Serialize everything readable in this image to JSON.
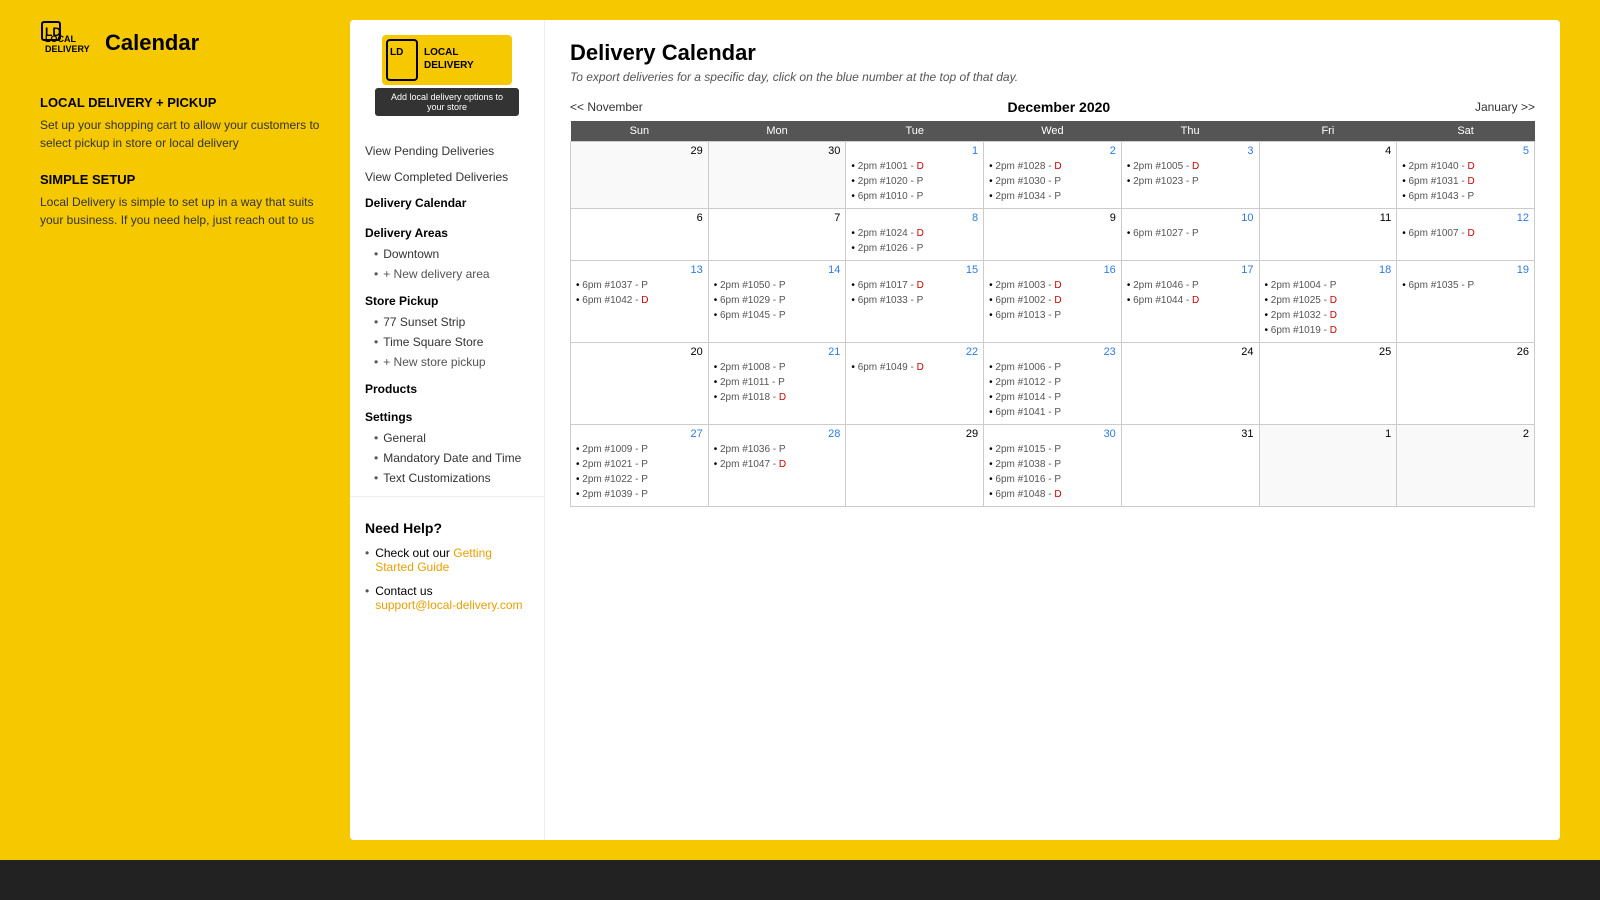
{
  "header": {
    "logo_text": "Calendar"
  },
  "left_panel": {
    "sections": [
      {
        "title": "LOCAL DELIVERY + PICKUP",
        "content": "Set up your shopping cart to allow your customers to select pickup in store or local delivery"
      },
      {
        "title": "SIMPLE SETUP",
        "content": "Local Delivery is simple to set up in a way that suits your business. If you need help, just reach out to us"
      }
    ]
  },
  "sidebar": {
    "logo_alt": "Local Delivery",
    "add_btn": "Add local delivery options to your store",
    "nav_items": [
      {
        "label": "View Pending Deliveries",
        "active": false
      },
      {
        "label": "View Completed Deliveries",
        "active": false
      },
      {
        "label": "Delivery Calendar",
        "active": true
      }
    ],
    "delivery_areas": {
      "title": "Delivery Areas",
      "items": [
        "Downtown",
        "+ New delivery area"
      ]
    },
    "store_pickup": {
      "title": "Store Pickup",
      "items": [
        "77 Sunset Strip",
        "Time Square Store",
        "+ New store pickup"
      ]
    },
    "products": {
      "title": "Products"
    },
    "settings": {
      "title": "Settings",
      "items": [
        "General",
        "Mandatory Date and Time",
        "Text Customizations"
      ]
    }
  },
  "calendar": {
    "title": "Delivery Calendar",
    "subtitle": "To export deliveries for a specific day, click on the blue number at the top of that day.",
    "prev_nav": "<< November",
    "next_nav": "January >>",
    "month_title": "December 2020",
    "headers": [
      "Sun",
      "Mon",
      "Tue",
      "Wed",
      "Thu",
      "Fri",
      "Sat"
    ],
    "weeks": [
      {
        "days": [
          {
            "number": "29",
            "grayed": true,
            "events": []
          },
          {
            "number": "30",
            "grayed": true,
            "events": []
          },
          {
            "number": "1",
            "blue": true,
            "events": [
              {
                "time": "2pm",
                "order": "#1001",
                "type": "D"
              },
              {
                "time": "2pm",
                "order": "#1020",
                "type": "P"
              },
              {
                "time": "6pm",
                "order": "#1010",
                "type": "P"
              }
            ]
          },
          {
            "number": "2",
            "blue": true,
            "events": [
              {
                "time": "2pm",
                "order": "#1028",
                "type": "D"
              },
              {
                "time": "2pm",
                "order": "#1030",
                "type": "P"
              },
              {
                "time": "2pm",
                "order": "#1034",
                "type": "P"
              }
            ]
          },
          {
            "number": "3",
            "blue": true,
            "events": [
              {
                "time": "2pm",
                "order": "#1005",
                "type": "D"
              },
              {
                "time": "2pm",
                "order": "#1023",
                "type": "P"
              }
            ]
          },
          {
            "number": "4",
            "events": []
          },
          {
            "number": "5",
            "blue": true,
            "events": [
              {
                "time": "2pm",
                "order": "#1040",
                "type": "D"
              },
              {
                "time": "6pm",
                "order": "#1031",
                "type": "D"
              },
              {
                "time": "6pm",
                "order": "#1043",
                "type": "P"
              }
            ]
          }
        ]
      },
      {
        "days": [
          {
            "number": "6",
            "events": []
          },
          {
            "number": "7",
            "events": []
          },
          {
            "number": "8",
            "blue": true,
            "events": [
              {
                "time": "2pm",
                "order": "#1024",
                "type": "D"
              },
              {
                "time": "2pm",
                "order": "#1026",
                "type": "P"
              }
            ]
          },
          {
            "number": "9",
            "events": []
          },
          {
            "number": "10",
            "blue": true,
            "events": [
              {
                "time": "6pm",
                "order": "#1027",
                "type": "P"
              }
            ]
          },
          {
            "number": "11",
            "events": []
          },
          {
            "number": "12",
            "blue": true,
            "events": [
              {
                "time": "6pm",
                "order": "#1007",
                "type": "D"
              }
            ]
          }
        ]
      },
      {
        "days": [
          {
            "number": "13",
            "blue": true,
            "events": [
              {
                "time": "6pm",
                "order": "#1037",
                "type": "P"
              },
              {
                "time": "6pm",
                "order": "#1042",
                "type": "D"
              }
            ]
          },
          {
            "number": "14",
            "blue": true,
            "events": [
              {
                "time": "2pm",
                "order": "#1050",
                "type": "P"
              },
              {
                "time": "6pm",
                "order": "#1029",
                "type": "P"
              },
              {
                "time": "6pm",
                "order": "#1045",
                "type": "P"
              }
            ]
          },
          {
            "number": "15",
            "blue": true,
            "events": [
              {
                "time": "6pm",
                "order": "#1017",
                "type": "D"
              },
              {
                "time": "6pm",
                "order": "#1033",
                "type": "P"
              }
            ]
          },
          {
            "number": "16",
            "blue": true,
            "events": [
              {
                "time": "2pm",
                "order": "#1003",
                "type": "D"
              },
              {
                "time": "6pm",
                "order": "#1002",
                "type": "D"
              },
              {
                "time": "6pm",
                "order": "#1013",
                "type": "P"
              }
            ]
          },
          {
            "number": "17",
            "blue": true,
            "events": [
              {
                "time": "2pm",
                "order": "#1046",
                "type": "P"
              },
              {
                "time": "6pm",
                "order": "#1044",
                "type": "D"
              }
            ]
          },
          {
            "number": "18",
            "blue": true,
            "events": [
              {
                "time": "2pm",
                "order": "#1004",
                "type": "P"
              },
              {
                "time": "2pm",
                "order": "#1025",
                "type": "D"
              },
              {
                "time": "2pm",
                "order": "#1032",
                "type": "D"
              },
              {
                "time": "6pm",
                "order": "#1019",
                "type": "D"
              }
            ]
          },
          {
            "number": "19",
            "blue": true,
            "events": [
              {
                "time": "6pm",
                "order": "#1035",
                "type": "P"
              }
            ]
          }
        ]
      },
      {
        "days": [
          {
            "number": "20",
            "events": []
          },
          {
            "number": "21",
            "blue": true,
            "events": [
              {
                "time": "2pm",
                "order": "#1008",
                "type": "P"
              },
              {
                "time": "2pm",
                "order": "#1011",
                "type": "P"
              },
              {
                "time": "2pm",
                "order": "#1018",
                "type": "D"
              }
            ]
          },
          {
            "number": "22",
            "blue": true,
            "events": [
              {
                "time": "6pm",
                "order": "#1049",
                "type": "D"
              }
            ]
          },
          {
            "number": "23",
            "blue": true,
            "events": [
              {
                "time": "2pm",
                "order": "#1006",
                "type": "P"
              },
              {
                "time": "2pm",
                "order": "#1012",
                "type": "P"
              },
              {
                "time": "2pm",
                "order": "#1014",
                "type": "P"
              },
              {
                "time": "6pm",
                "order": "#1041",
                "type": "P"
              }
            ]
          },
          {
            "number": "24",
            "events": []
          },
          {
            "number": "25",
            "events": []
          },
          {
            "number": "26",
            "events": []
          }
        ]
      },
      {
        "days": [
          {
            "number": "27",
            "blue": true,
            "events": [
              {
                "time": "2pm",
                "order": "#1009",
                "type": "P"
              },
              {
                "time": "2pm",
                "order": "#1021",
                "type": "P"
              },
              {
                "time": "2pm",
                "order": "#1022",
                "type": "P"
              },
              {
                "time": "2pm",
                "order": "#1039",
                "type": "P"
              }
            ]
          },
          {
            "number": "28",
            "blue": true,
            "events": [
              {
                "time": "2pm",
                "order": "#1036",
                "type": "P"
              },
              {
                "time": "2pm",
                "order": "#1047",
                "type": "D"
              }
            ]
          },
          {
            "number": "29",
            "events": []
          },
          {
            "number": "30",
            "blue": true,
            "events": [
              {
                "time": "2pm",
                "order": "#1015",
                "type": "P"
              },
              {
                "time": "2pm",
                "order": "#1038",
                "type": "P"
              },
              {
                "time": "6pm",
                "order": "#1016",
                "type": "P"
              },
              {
                "time": "6pm",
                "order": "#1048",
                "type": "D"
              }
            ]
          },
          {
            "number": "31",
            "events": []
          },
          {
            "number": "1",
            "grayed": true,
            "events": []
          },
          {
            "number": "2",
            "grayed": true,
            "events": []
          }
        ]
      }
    ]
  },
  "need_help": {
    "title": "Need Help?",
    "items": [
      {
        "text": "Check out our ",
        "link_text": "Getting Started Guide",
        "has_link": true
      },
      {
        "text": "Contact us",
        "sub_text": "support@local-delivery.com",
        "has_link": false
      }
    ]
  }
}
